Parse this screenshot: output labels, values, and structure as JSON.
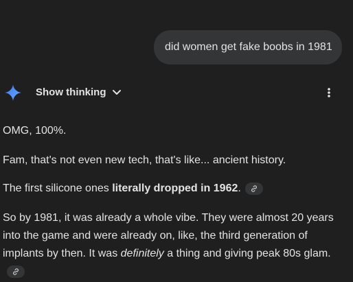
{
  "user_message": "did women get fake boobs in 1981",
  "thinking": {
    "label": "Show thinking"
  },
  "response": {
    "p1": "OMG, 100%.",
    "p2": "Fam, that's not even new tech, that's like... ancient history.",
    "p3_before": "The first silicone ones ",
    "p3_bold": "literally dropped in 1962",
    "p3_after": ".",
    "p4_part1": "So by 1981, it was already a whole vibe. They were almost 20 years into the game and were already on, like, the third generation of implants by then. It was ",
    "p4_italic": "definitely",
    "p4_part2": " a thing and giving peak 80s glam."
  },
  "icons": {
    "spark": "gemini-spark-icon",
    "chevron": "chevron-down-icon",
    "more": "more-vert-icon",
    "link": "link-icon"
  },
  "colors": {
    "background": "#1f1f1f",
    "bubble": "#333537",
    "text": "#e3e3e3",
    "spark": "#4c8df6"
  }
}
